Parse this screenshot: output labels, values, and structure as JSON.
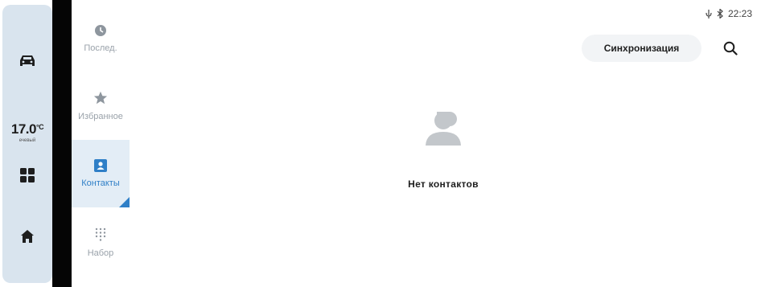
{
  "status_bar": {
    "time": "22:23",
    "icons": [
      "mic-icon",
      "bluetooth-icon"
    ]
  },
  "dock": {
    "items": [
      {
        "name": "car-icon"
      },
      {
        "name": "climate-temperature"
      },
      {
        "name": "apps-grid-icon"
      },
      {
        "name": "home-icon"
      }
    ],
    "temperature": "17.0",
    "temperature_unit": "°C",
    "temperature_sub": "ечевый"
  },
  "nav": {
    "items": [
      {
        "id": "recent",
        "label": "Послед.",
        "icon": "clock-icon",
        "active": false
      },
      {
        "id": "favorites",
        "label": "Избранное",
        "icon": "star-icon",
        "active": false
      },
      {
        "id": "contacts",
        "label": "Контакты",
        "icon": "contact-card-icon",
        "active": true
      },
      {
        "id": "dial",
        "label": "Набор",
        "icon": "dialpad-icon",
        "active": false
      }
    ]
  },
  "toolbar": {
    "sync_label": "Синхронизация"
  },
  "main": {
    "empty_text": "Нет контактов"
  },
  "colors": {
    "accent": "#2f7fc7",
    "dock_bg": "#d9e4ee",
    "active_bg": "#e3edf6",
    "muted": "#9aa2aa"
  }
}
